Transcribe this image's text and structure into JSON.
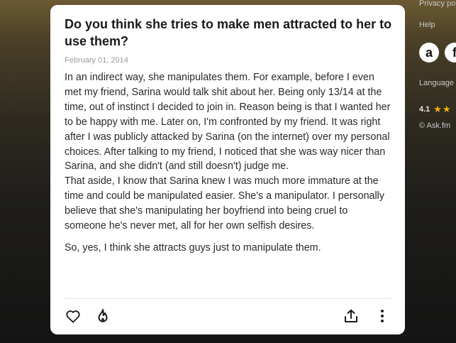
{
  "question": {
    "title": "Do you think she tries to make men attracted to her to use them?",
    "date": "February 01, 2014"
  },
  "answer": {
    "body": "In an indirect way, she manipulates them. For example, before I even met my friend, Sarina would talk shit about her. Being only 13/14 at the time, out of instinct I decided to join in. Reason being is that I wanted her to be happy with me. Later on, I'm confronted by my friend. It was right after I was publicly attacked by Sarina (on the internet) over my personal choices. After talking to my friend, I noticed that she was way nicer than Sarina, and she didn't (and still doesn't) judge me.\nThat aside, I know that Sarina knew I was much more immature at the time and could be manipulated easier. She's a manipulator. I personally believe that she's manipulating her boyfriend into being cruel to someone he's never met, all for her own selfish desires.",
    "closing": "So, yes, I think she attracts guys just to manipulate them."
  },
  "actions": {
    "like_icon": "heart-icon",
    "fire_icon": "fire-icon",
    "share_icon": "share-icon",
    "more_icon": "more-vertical-icon"
  },
  "sidebar": {
    "privacy": "Privacy po",
    "help": "Help",
    "app_icon_letter": "a",
    "app_icon_2_letter": "f",
    "language": "Language",
    "rating_value": "4.1",
    "rating_stars": "★★",
    "copyright": "© Ask.fm"
  },
  "colors": {
    "card_bg": "#ffffff",
    "text": "#2a2a2a",
    "muted": "#9a9a9a",
    "star": "#f5b301"
  }
}
